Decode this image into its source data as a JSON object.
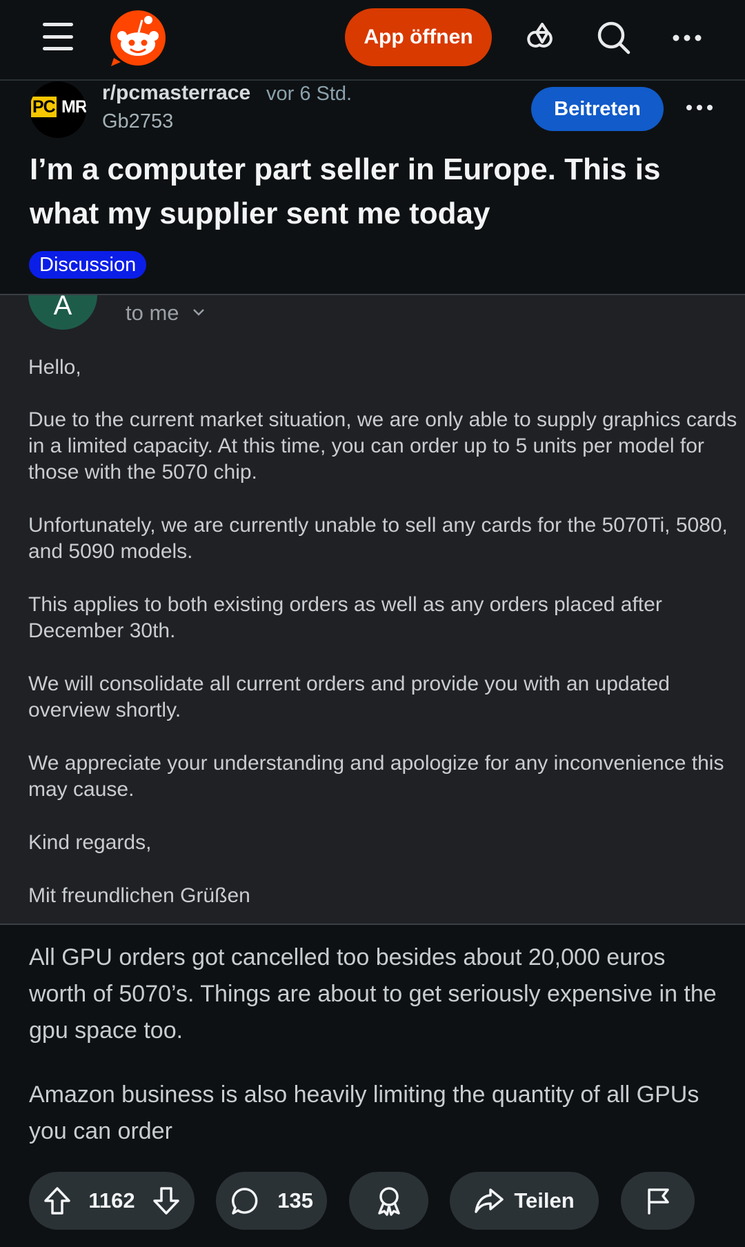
{
  "topbar": {
    "app_button_label": "App öffnen",
    "icons": [
      "menu-icon",
      "reddit-logo",
      "answers-icon",
      "search-icon",
      "more-icon"
    ]
  },
  "post": {
    "subreddit": "r/pcmasterrace",
    "time": "vor 6 Std.",
    "author": "Gb2753",
    "join_label": "Beitreten",
    "avatar_text_a": "PC",
    "avatar_text_b": "MR",
    "title": "I’m a computer part seller in Europe. This is what my supplier sent me today",
    "flair": "Discussion"
  },
  "media": {
    "sender_initial": "A",
    "to_me": "to me",
    "paragraphs": [
      "Hello,",
      "Due to the current market situation, we are only able to supply graphics cards in a limited capacity. At this time, you can order up to 5 units per model for those with the 5070 chip.",
      "Unfortunately, we are currently unable to sell any cards for the 5070Ti, 5080, and 5090 models.",
      "This applies to both existing orders as well as any orders placed after December 30th.",
      "We will consolidate all current orders and provide you with an updated overview shortly.",
      "We appreciate your understanding and apologize for any inconvenience this may cause.",
      "Kind regards,",
      "Mit freundlichen Grüßen"
    ]
  },
  "body": {
    "paragraphs": [
      "All GPU orders got cancelled too besides about 20,000 euros worth of 5070’s. Things are about to get seriously expensive in the gpu space too.",
      "Amazon business is also heavily limiting the quantity of all GPUs you can order"
    ]
  },
  "actions": {
    "votes": "1162",
    "comments": "135",
    "share_label": "Teilen"
  },
  "colors": {
    "background": "#0e1113",
    "accent_orange": "#d93a00",
    "join_blue": "#115bca",
    "flair_blue": "#0b1ee8",
    "pill_bg": "#2a3236"
  }
}
